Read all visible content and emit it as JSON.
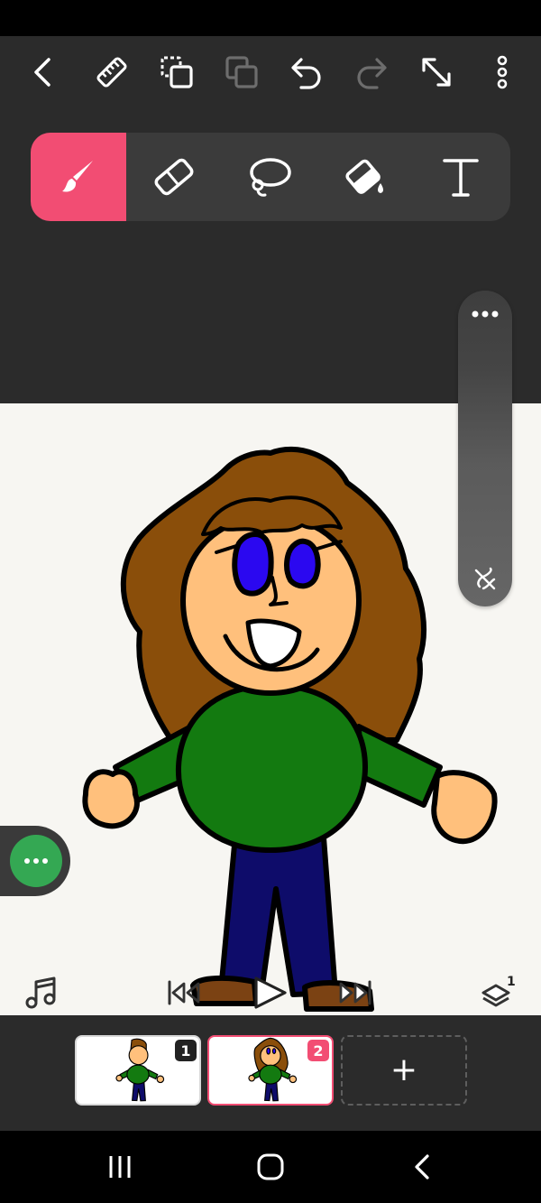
{
  "toolbar": {
    "buttons": [
      "back-icon",
      "ruler-icon",
      "select-copy-icon",
      "duplicate-icon",
      "undo-icon",
      "redo-icon",
      "fullscreen-icon",
      "more-vertical-icon"
    ]
  },
  "tools": [
    {
      "name": "brush-tool",
      "icon": "brush-icon",
      "active": true
    },
    {
      "name": "eraser-tool",
      "icon": "eraser-icon",
      "active": false
    },
    {
      "name": "lasso-tool",
      "icon": "lasso-icon",
      "active": false
    },
    {
      "name": "fill-tool",
      "icon": "paint-bucket-icon",
      "active": false
    },
    {
      "name": "text-tool",
      "icon": "text-icon",
      "active": false
    }
  ],
  "colors": {
    "accent": "#f24d73",
    "green_button": "#34a853",
    "dark": "#2b2b2b"
  },
  "playback": {
    "layer_count": "1"
  },
  "frames": [
    {
      "number": "1",
      "selected": false
    },
    {
      "number": "2",
      "selected": true
    }
  ],
  "add_frame_label": "+"
}
